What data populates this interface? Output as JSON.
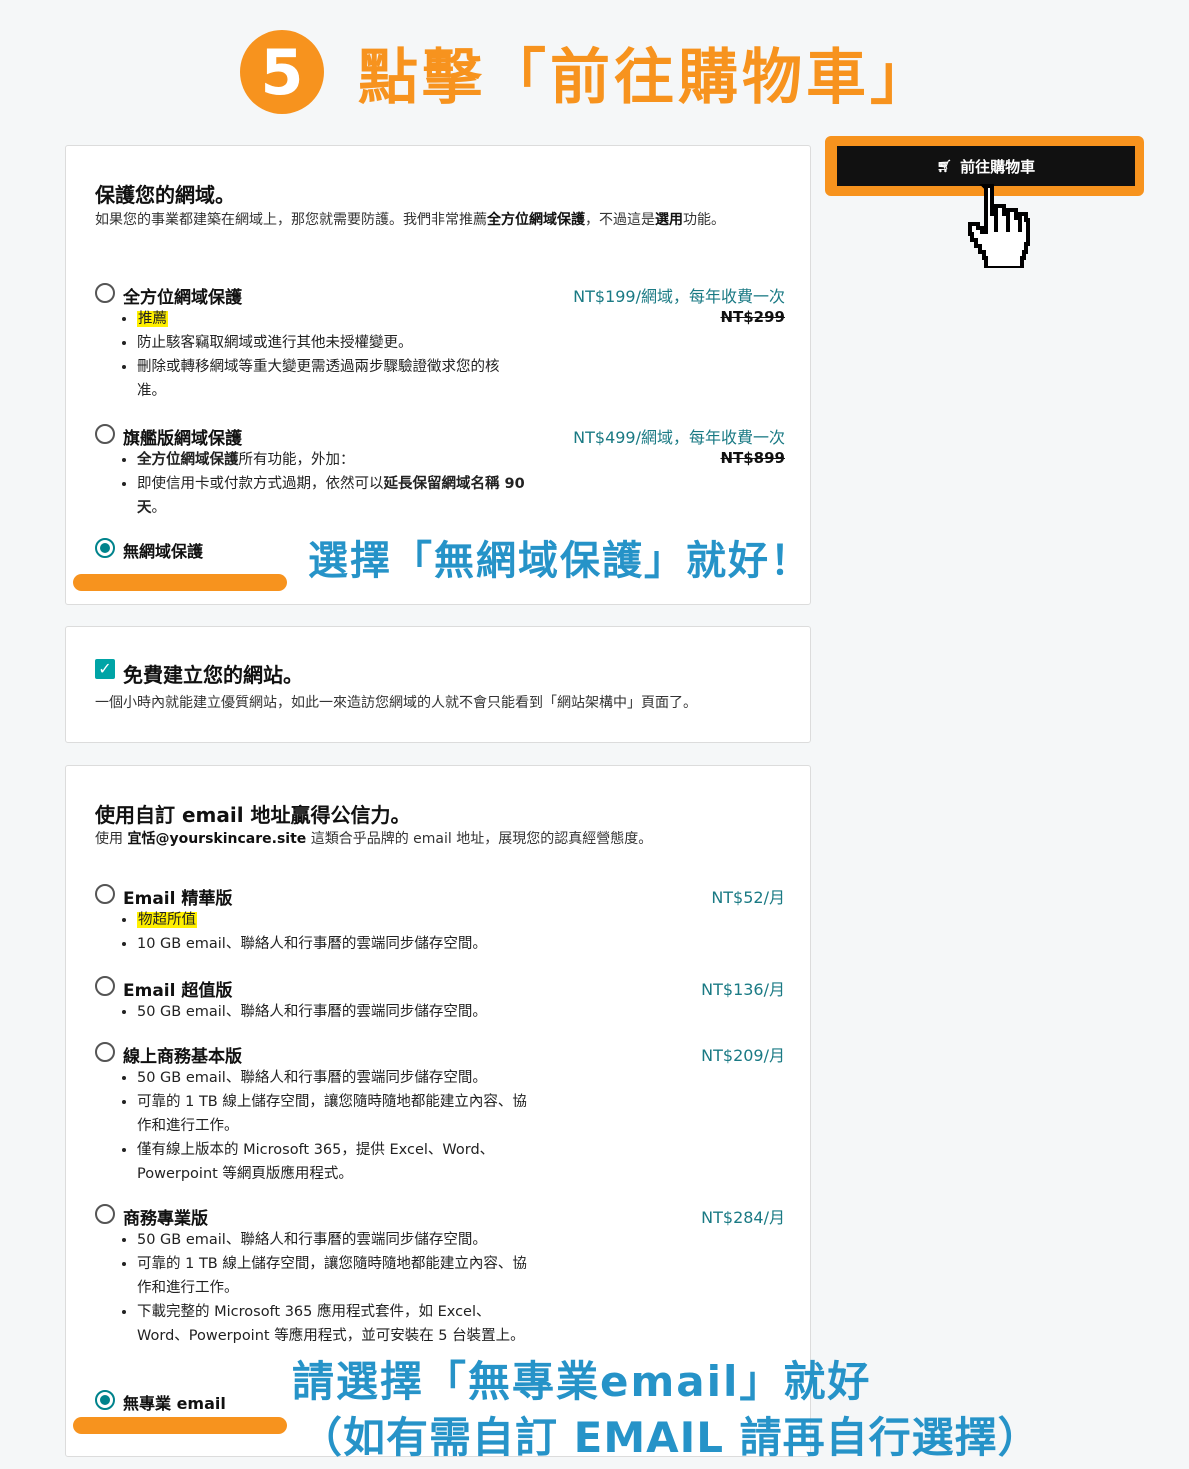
{
  "annotation": {
    "step_number": "5",
    "step_title": "點擊「前往購物車」",
    "domain_note": "選擇「無網域保護」就好！",
    "email_note_line1": "請選擇「無專業email」就好",
    "email_note_line2": "（如有需自訂 EMAIL 請再自行選擇）",
    "accent_color": "#f7931e",
    "note_color": "#2693c8"
  },
  "cart": {
    "icon": "cart-icon",
    "label": "前往購物車"
  },
  "domain_protection": {
    "title": "保護您的網域。",
    "description_part1": "如果您的事業都建築在網域上，那您就需要防護。我們非常推薦",
    "description_bold1": "全方位網域保護",
    "description_part2": "，不過這是",
    "description_bold2": "選用",
    "description_part3": "功能。",
    "options": [
      {
        "name": "全方位網域保護",
        "price": "NT$199/網域，每年收費一次",
        "old_price": "NT$299",
        "badge": "推薦",
        "bullets": [
          "防止駭客竊取網域或進行其他未授權變更。",
          "刪除或轉移網域等重大變更需透過兩步驟驗證徵求您的核准。"
        ],
        "selected": false
      },
      {
        "name": "旗艦版網域保護",
        "price": "NT$499/網域，每年收費一次",
        "old_price": "NT$899",
        "bullet1_bold": "全方位網域保護",
        "bullet1_rest": "所有功能，外加：",
        "bullet2_part1": "即使信用卡或付款方式過期，依然可以",
        "bullet2_bold": "延長保留網域名稱 90 天",
        "bullet2_part2": "。",
        "selected": false
      },
      {
        "name": "無網域保護",
        "selected": true
      }
    ]
  },
  "free_site": {
    "checked": true,
    "title": "免費建立您的網站。",
    "description": "一個小時內就能建立優質網站，如此一來造訪您網域的人就不會只能看到「網站架構中」頁面了。"
  },
  "email": {
    "title": "使用自訂 email 地址贏得公信力。",
    "description_prefix": "使用 ",
    "description_address": "宜恬@yourskincare.site",
    "description_suffix": " 這類合乎品牌的 email 地址，展現您的認真經營態度。",
    "options": [
      {
        "name": "Email 精華版",
        "price": "NT$52/月",
        "badge": "物超所值",
        "bullets": [
          "10 GB email、聯絡人和行事曆的雲端同步儲存空間。"
        ],
        "selected": false
      },
      {
        "name": "Email 超值版",
        "price": "NT$136/月",
        "bullets": [
          "50 GB email、聯絡人和行事曆的雲端同步儲存空間。"
        ],
        "selected": false
      },
      {
        "name": "線上商務基本版",
        "price": "NT$209/月",
        "bullets": [
          "50 GB email、聯絡人和行事曆的雲端同步儲存空間。",
          "可靠的 1 TB 線上儲存空間，讓您隨時隨地都能建立內容、協作和進行工作。",
          "僅有線上版本的 Microsoft 365，提供 Excel、Word、Powerpoint 等網頁版應用程式。"
        ],
        "selected": false
      },
      {
        "name": "商務專業版",
        "price": "NT$284/月",
        "bullets": [
          "50 GB email、聯絡人和行事曆的雲端同步儲存空間。",
          "可靠的 1 TB 線上儲存空間，讓您隨時隨地都能建立內容、協作和進行工作。",
          "下載完整的 Microsoft 365 應用程式套件，如 Excel、Word、Powerpoint 等應用程式，並可安裝在 5 台裝置上。"
        ],
        "selected": false
      },
      {
        "name": "無專業 email",
        "selected": true
      }
    ]
  }
}
